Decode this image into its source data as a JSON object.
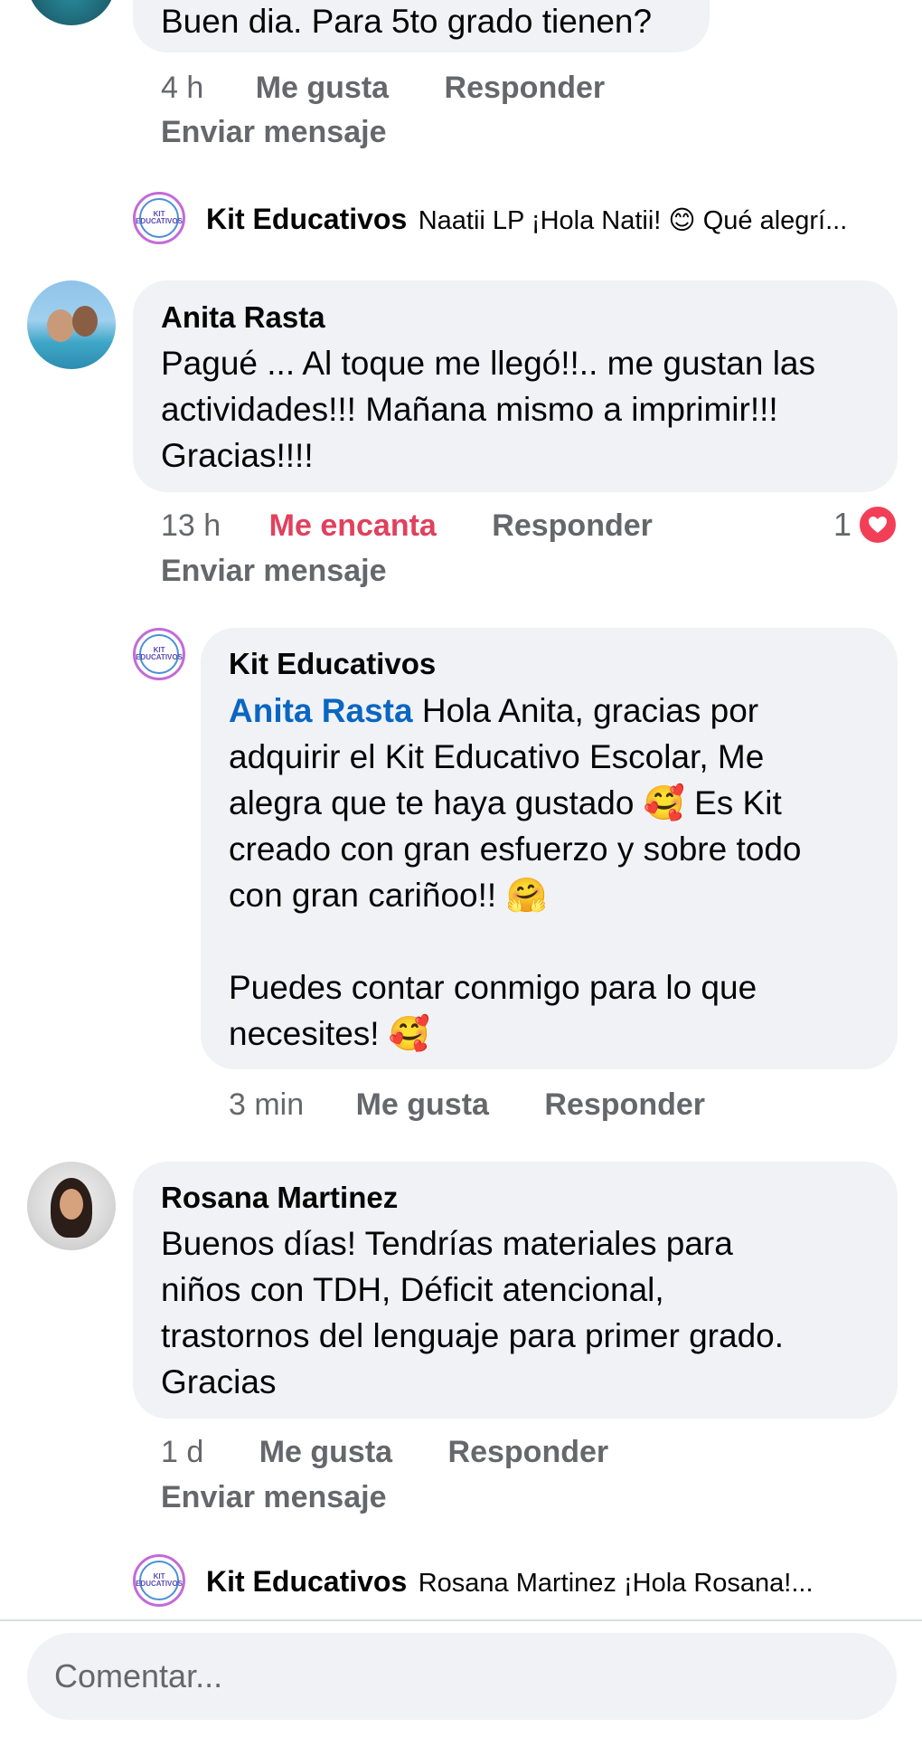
{
  "comments": [
    {
      "text": "Buen dia. Para 5to grado tienen?",
      "time": "4 h",
      "like": "Me gusta",
      "reply": "Responder",
      "send": "Enviar mensaje",
      "reply_preview": {
        "author": "Kit Educativos",
        "text": "Naatii LP ¡Hola Natii! 😊 Qué alegrí..."
      }
    },
    {
      "author": "Anita Rasta",
      "text": "Pagué ... Al toque me llegó!!.. me gustan las\nactividades!!! Mañana mismo a imprimir!!!\nGracias!!!!",
      "time": "13 h",
      "like": "Me encanta",
      "reply": "Responder",
      "reaction_count": "1",
      "send": "Enviar mensaje",
      "reply_full": {
        "author": "Kit Educativos",
        "mention": "Anita Rasta",
        "text_line1": " Hola Anita, gracias por",
        "text_rest": "adquirir el Kit Educativo Escolar, Me\nalegra que te haya gustado 🥰 Es Kit\ncreado con gran esfuerzo y sobre todo\ncon gran cariñoo!! 🤗\n\nPuedes contar conmigo para lo que\nnecesites! 🥰",
        "time": "3 min",
        "like": "Me gusta",
        "reply": "Responder"
      }
    },
    {
      "author": "Rosana Martinez",
      "text": "Buenos días! Tendrías materiales para\nniños con TDH, Déficit atencional,\ntrastornos del lenguaje para primer grado.\nGracias",
      "time": "1 d",
      "like": "Me gusta",
      "reply": "Responder",
      "send": "Enviar mensaje",
      "reply_preview": {
        "author": "Kit Educativos",
        "text": "Rosana Martinez ¡Hola Rosana!..."
      }
    }
  ],
  "logo_text": "KIT EDUCATIVOS",
  "composer": {
    "placeholder": "Comentar..."
  },
  "colors": {
    "loved": "#e0415e",
    "mention": "#0a66c2",
    "bubble": "#f0f2f5",
    "meta": "#65676b"
  },
  "icons": [
    "avatar",
    "kit-logo-icon",
    "heart-reaction-icon"
  ]
}
